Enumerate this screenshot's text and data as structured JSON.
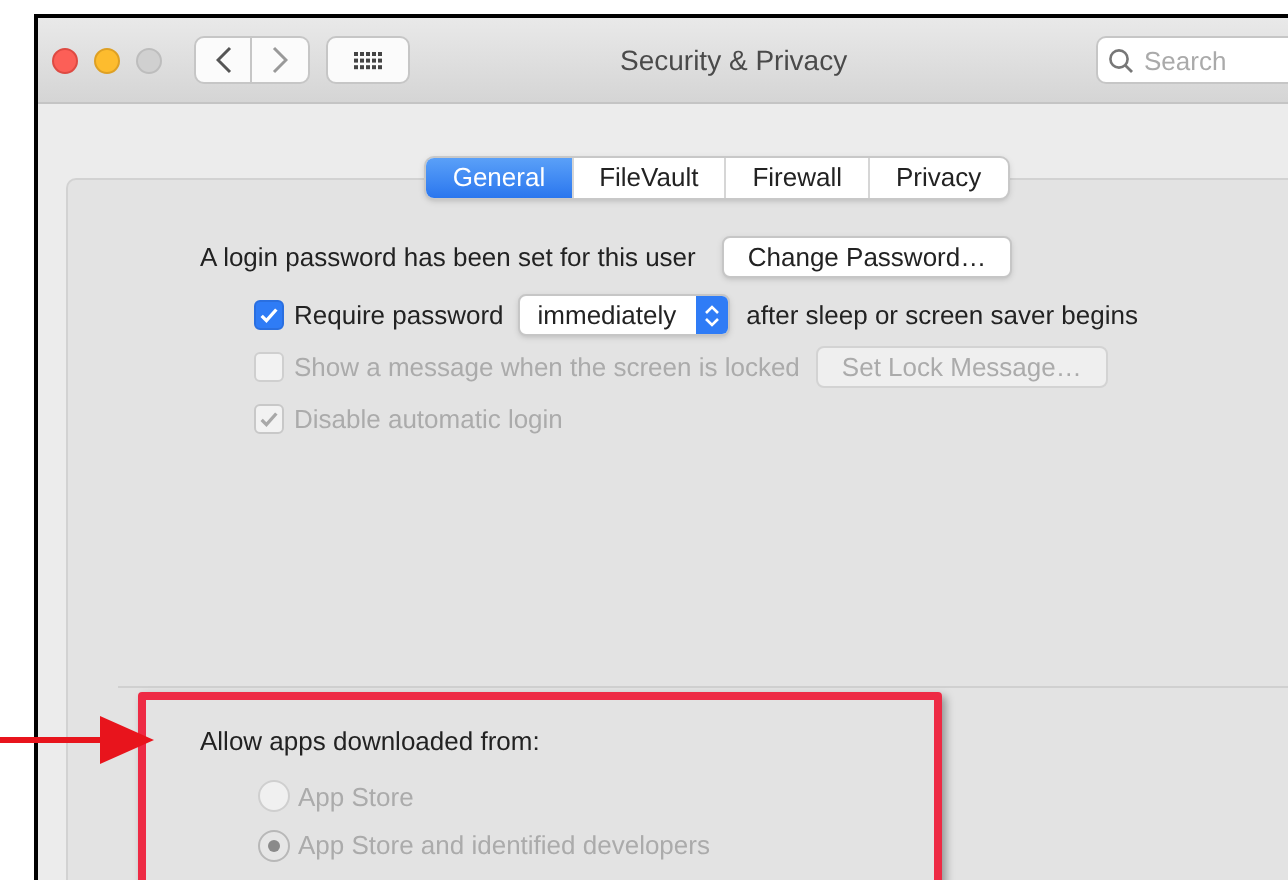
{
  "window": {
    "title": "Security & Privacy"
  },
  "search": {
    "placeholder": "Search"
  },
  "tabs": [
    {
      "label": "General",
      "selected": true
    },
    {
      "label": "FileVault",
      "selected": false
    },
    {
      "label": "Firewall",
      "selected": false
    },
    {
      "label": "Privacy",
      "selected": false
    }
  ],
  "login": {
    "message": "A login password has been set for this user",
    "button": "Change Password…"
  },
  "options": [
    {
      "kind": "select",
      "label": "Require password",
      "checked": true,
      "disabled": false,
      "value": "immediately",
      "suffix": "after sleep or screen saver begins"
    },
    {
      "kind": "button",
      "label": "Show a message when the screen is locked",
      "checked": false,
      "disabled": true,
      "button": "Set Lock Message…"
    },
    {
      "kind": "plain",
      "label": "Disable automatic login",
      "checked": true,
      "disabled": true
    }
  ],
  "gatekeeper": {
    "heading": "Allow apps downloaded from:",
    "highlighted": true,
    "choices": [
      {
        "label": "App Store",
        "selected": false,
        "disabled": true
      },
      {
        "label": "App Store and identified developers",
        "selected": true,
        "disabled": true
      }
    ]
  }
}
